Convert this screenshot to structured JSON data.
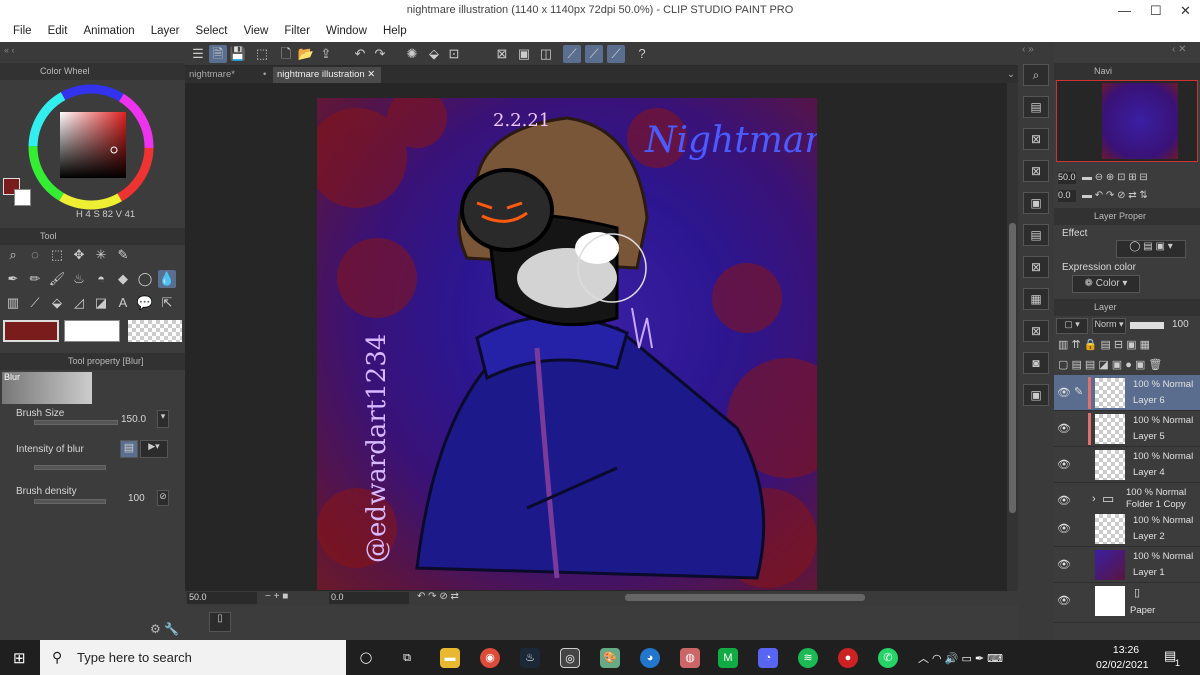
{
  "window": {
    "title": "nightmare illustration (1140 x 1140px 72dpi 50.0%)  - CLIP STUDIO PAINT PRO",
    "minimize": "—",
    "maximize": "☐",
    "close": "✕"
  },
  "menu": [
    "File",
    "Edit",
    "Animation",
    "Layer",
    "Select",
    "View",
    "Filter",
    "Window",
    "Help"
  ],
  "color_wheel": {
    "panel_title": "Color Wheel",
    "h": "4",
    "s": "82",
    "v": "41",
    "main_color": "#7a1c1c",
    "sub_color": "#ffffff"
  },
  "tool": {
    "panel_title": "Tool"
  },
  "tool_property": {
    "panel_title": "Tool property [Blur]",
    "tool_name": "Blur",
    "brush_size_label": "Brush Size",
    "brush_size_value": "150.0",
    "intensity_label": "Intensity of blur",
    "density_label": "Brush density",
    "density_value": "100"
  },
  "tabs": [
    {
      "label": "nightmare*"
    },
    {
      "label": "nightmare illustration"
    }
  ],
  "artwork": {
    "date": "2.2.21",
    "signature": "Nightmare",
    "handle": "@edwardart1234"
  },
  "canvas_status": {
    "zoom": "50.0",
    "angle": "0.0"
  },
  "navigator": {
    "panel_title": "Navi",
    "zoom": "50.0",
    "angle": "0.0"
  },
  "layer_property": {
    "panel_title": "Layer Proper",
    "effect_label": "Effect",
    "expression_label": "Expression color",
    "expression_value": "Color"
  },
  "layer_panel": {
    "panel_title": "Layer",
    "blend_mode": "Norm",
    "opacity": "100"
  },
  "layers": [
    {
      "blend": "100 % Normal",
      "name": "Layer 6",
      "selected": true
    },
    {
      "blend": "100 % Normal",
      "name": "Layer 5",
      "selected": false
    },
    {
      "blend": "100 % Normal",
      "name": "Layer 4",
      "selected": false
    },
    {
      "blend": "100 % Normal",
      "name": "Folder 1 Copy",
      "selected": false
    },
    {
      "blend": "100 % Normal",
      "name": "Layer 2",
      "selected": false
    },
    {
      "blend": "100 % Normal",
      "name": "Layer 1",
      "selected": false
    },
    {
      "blend": "",
      "name": "Paper",
      "selected": false
    }
  ],
  "taskbar": {
    "search_placeholder": "Type here to search",
    "time": "13:26",
    "date": "02/02/2021",
    "notifications": "1"
  }
}
